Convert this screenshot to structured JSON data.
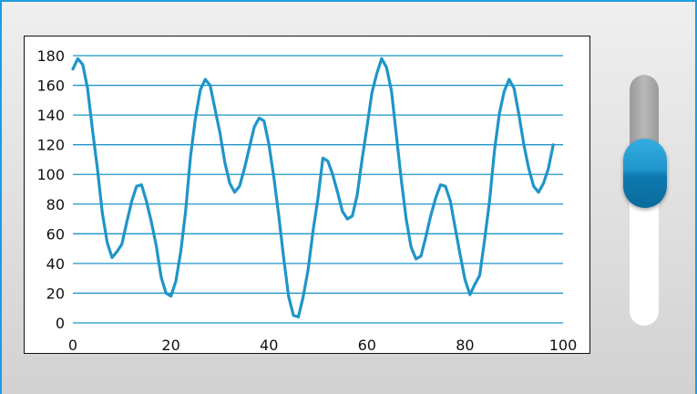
{
  "colors": {
    "accent": "#1d9ce0",
    "series_line": "#1f95c8",
    "gridline": "#1f95c8",
    "slider_thumb": "#1f95cc",
    "slider_fill": "#aaaaaa"
  },
  "slider": {
    "orientation": "vertical",
    "level": 0.65
  },
  "chart_data": {
    "type": "line",
    "title": "",
    "xlabel": "",
    "ylabel": "",
    "xlim": [
      0,
      100
    ],
    "ylim": [
      0,
      180
    ],
    "x_ticks": [
      0,
      20,
      40,
      60,
      80,
      100
    ],
    "y_ticks": [
      0,
      20,
      40,
      60,
      80,
      100,
      120,
      140,
      160,
      180
    ],
    "grid": "horizontal",
    "legend": "none",
    "series": [
      {
        "x": [
          0,
          1,
          2,
          3,
          4,
          5,
          6,
          7,
          8,
          9,
          10,
          11,
          12,
          13,
          14,
          15,
          16,
          17,
          18,
          19,
          20,
          21,
          22,
          23,
          24,
          25,
          26,
          27,
          28,
          29,
          30,
          31,
          32,
          33,
          34,
          35,
          36,
          37,
          38,
          39,
          40,
          41,
          42,
          43,
          44,
          45,
          46,
          47,
          48,
          49,
          50,
          51,
          52,
          53,
          54,
          55,
          56,
          57,
          58,
          59,
          60,
          61,
          62,
          63,
          64,
          65,
          66,
          67,
          68,
          69,
          70,
          71,
          72,
          73,
          74,
          75,
          76,
          77,
          78,
          79,
          80,
          81,
          82,
          83,
          84,
          85,
          86,
          87,
          88,
          89,
          90,
          91,
          92,
          93,
          94,
          95,
          96,
          97,
          98
        ],
        "values": [
          171,
          178,
          174,
          158,
          130,
          104,
          74,
          54,
          44,
          48,
          53,
          68,
          82,
          92,
          93,
          82,
          68,
          52,
          31,
          20,
          18,
          28,
          48,
          75,
          112,
          138,
          157,
          164,
          160,
          144,
          128,
          108,
          94,
          88,
          92,
          104,
          118,
          132,
          138,
          136,
          120,
          98,
          72,
          44,
          18,
          5,
          4,
          18,
          36,
          62,
          84,
          111,
          109,
          100,
          88,
          75,
          70,
          72,
          86,
          110,
          132,
          155,
          168,
          178,
          172,
          156,
          126,
          96,
          70,
          51,
          43,
          45,
          58,
          72,
          84,
          93,
          92,
          82,
          64,
          46,
          29,
          19,
          26,
          32,
          56,
          82,
          116,
          141,
          156,
          164,
          158,
          140,
          120,
          104,
          92,
          88,
          94,
          104,
          120
        ]
      }
    ]
  }
}
